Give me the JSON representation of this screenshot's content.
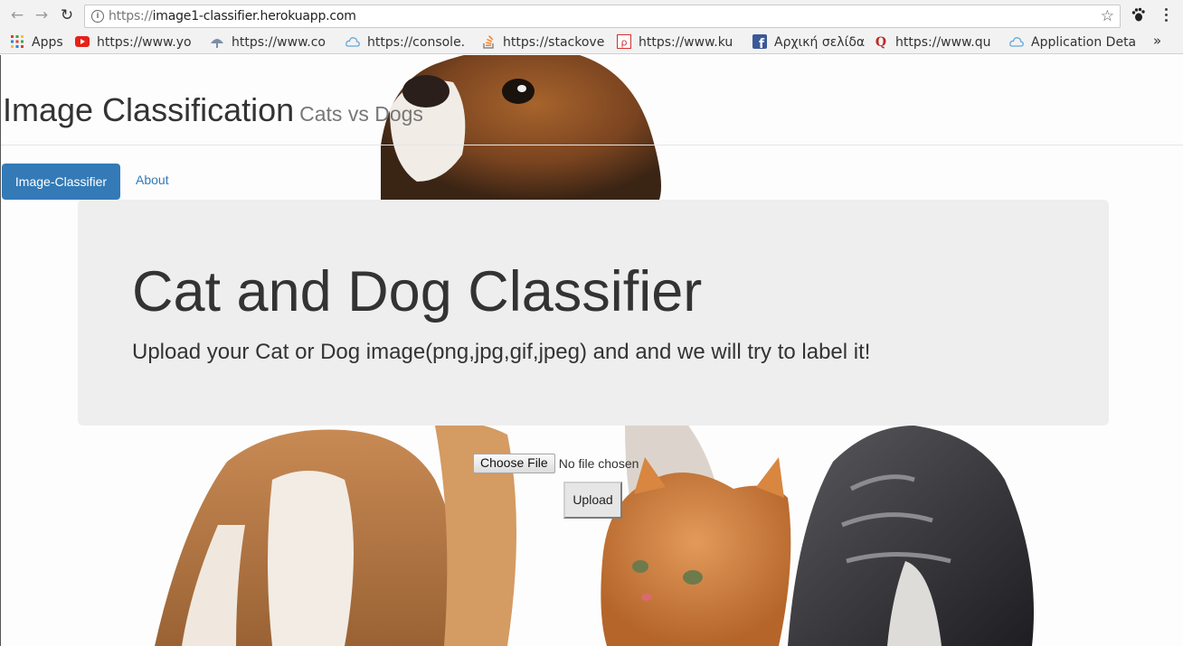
{
  "browser": {
    "url_scheme": "https://",
    "url_host": "image1-classifier.herokuapp.com",
    "bookmarks": [
      {
        "label": "Apps",
        "icon": "apps-grid-icon"
      },
      {
        "label": "https://www.yo",
        "icon": "youtube-icon"
      },
      {
        "label": "https://www.co",
        "icon": "coursera-icon"
      },
      {
        "label": "https://console.",
        "icon": "cloud-icon"
      },
      {
        "label": "https://stackove",
        "icon": "stackoverflow-icon"
      },
      {
        "label": "https://www.ku",
        "icon": "bookmark-red-icon"
      },
      {
        "label": "Αρχική σελίδα",
        "icon": "facebook-icon"
      },
      {
        "label": "https://www.qu",
        "icon": "quora-icon"
      },
      {
        "label": "Application Deta",
        "icon": "cloud-icon"
      }
    ],
    "more_label": "»"
  },
  "page": {
    "title": "Image Classification",
    "subtitle": "Cats vs Dogs",
    "tabs": [
      {
        "label": "Image-Classifier",
        "active": true
      },
      {
        "label": "About",
        "active": false
      }
    ],
    "jumbotron": {
      "heading": "Cat and Dog Classifier",
      "lead": "Upload your Cat or Dog image(png,jpg,gif,jpeg) and and we will try to label it!"
    },
    "file_input": {
      "button_label": "Choose File",
      "status": "No file chosen"
    },
    "upload_label": "Upload"
  },
  "colors": {
    "primary": "#337ab7",
    "jumbotron": "#eeeeee",
    "chrome": "#f2f2f2"
  }
}
